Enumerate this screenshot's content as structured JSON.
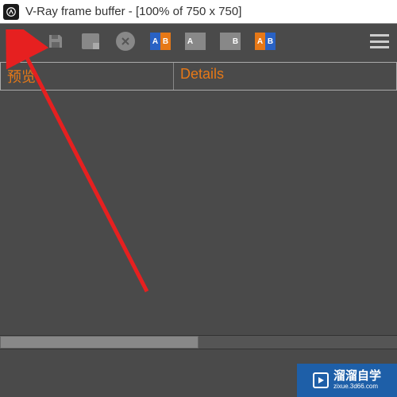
{
  "window": {
    "title": "V-Ray frame buffer - [100% of 750 x 750]"
  },
  "toolbar": {
    "power": "power",
    "save": "save",
    "clear": "clear",
    "close": "close",
    "ab_compare": "AB",
    "a_channel": "A",
    "b_channel": "B",
    "ab_swap": "AB",
    "menu": "menu"
  },
  "table": {
    "col1": "预览",
    "col2": "Details"
  },
  "watermark": {
    "brand": "溜溜自学",
    "url": "zixue.3d66.com"
  }
}
